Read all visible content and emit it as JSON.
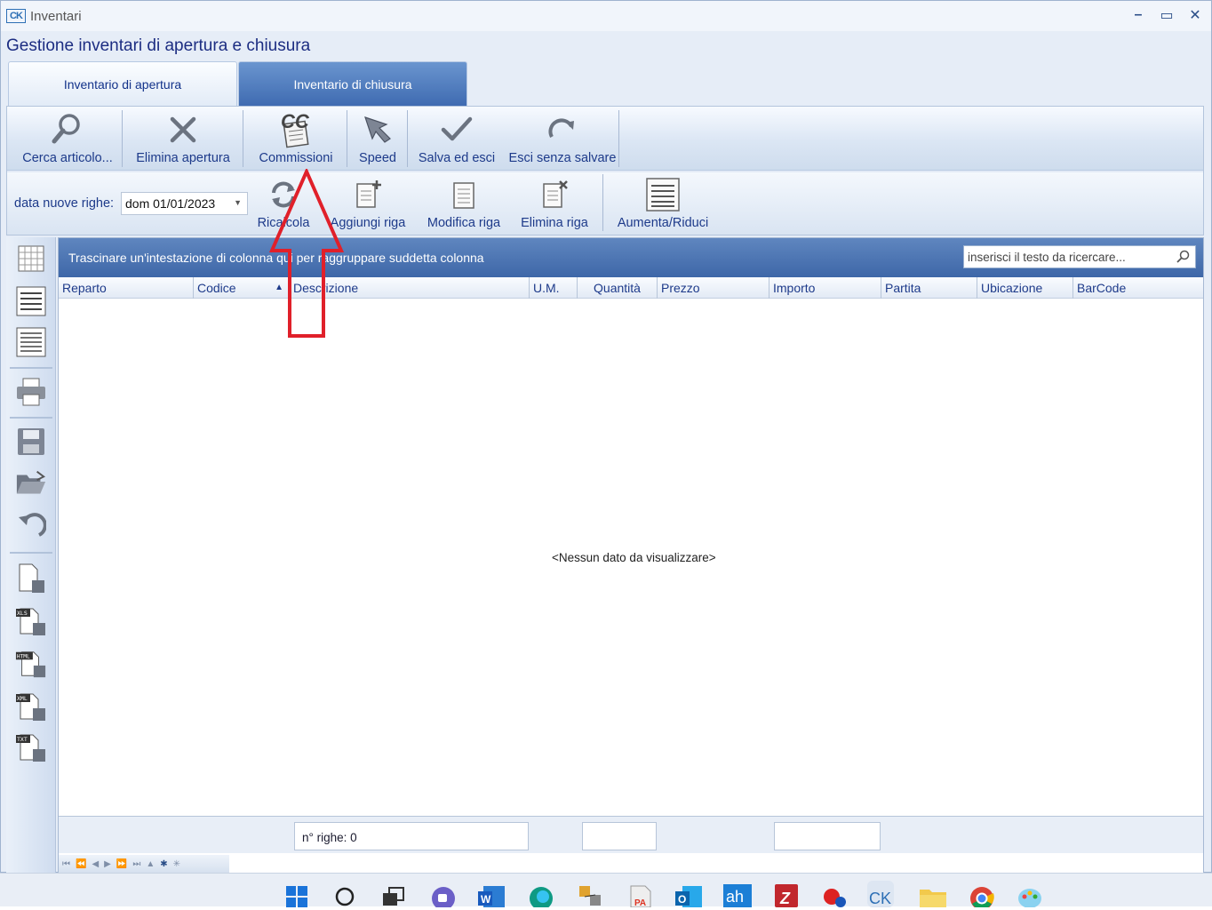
{
  "window": {
    "title": "Inventari",
    "controls": [
      "minimize",
      "maximize",
      "close"
    ]
  },
  "heading": "Gestione inventari di apertura e chiusura",
  "tabs": [
    {
      "label": "Inventario di apertura",
      "active": false
    },
    {
      "label": "Inventario di chiusura",
      "active": true
    }
  ],
  "toolbar": {
    "search_article": "Cerca articolo...",
    "delete_opening": "Elimina apertura",
    "commissions": "Commissioni",
    "speed": "Speed",
    "save_exit": "Salva ed esci",
    "exit_no_save": "Esci senza salvare"
  },
  "toolbar2": {
    "date_label": "data nuove righe:",
    "date_value": "dom 01/01/2023",
    "recalc": "Ricalcola",
    "add_row": "Aggiungi riga",
    "edit_row": "Modifica riga",
    "delete_row": "Elimina riga",
    "expand": "Aumenta/Riduci"
  },
  "grid": {
    "group_hint": "Trascinare un'intestazione di colonna qui per raggruppare suddetta colonna",
    "search_placeholder": "inserisci il testo da ricercare...",
    "columns": [
      "Reparto",
      "Codice",
      "Descrizione",
      "U.M.",
      "Quantità",
      "Prezzo",
      "Importo",
      "Partita",
      "Ubicazione",
      "BarCode"
    ],
    "sorted_column": "Codice",
    "empty_text": "<Nessun dato da visualizzare>",
    "row_count": "n° righe: 0"
  },
  "sidebar_icons": [
    "grid-icon",
    "list-icon",
    "lines-icon",
    "print-icon",
    "save-icon",
    "open-folder-icon",
    "undo-icon",
    "export-icon",
    "export-xls-icon",
    "export-html-icon",
    "export-xml-icon",
    "export-txt-icon"
  ],
  "colors": {
    "accent": "#3f6bb1",
    "title_text": "#1c2d82",
    "annotation_arrow": "#e0202a"
  }
}
